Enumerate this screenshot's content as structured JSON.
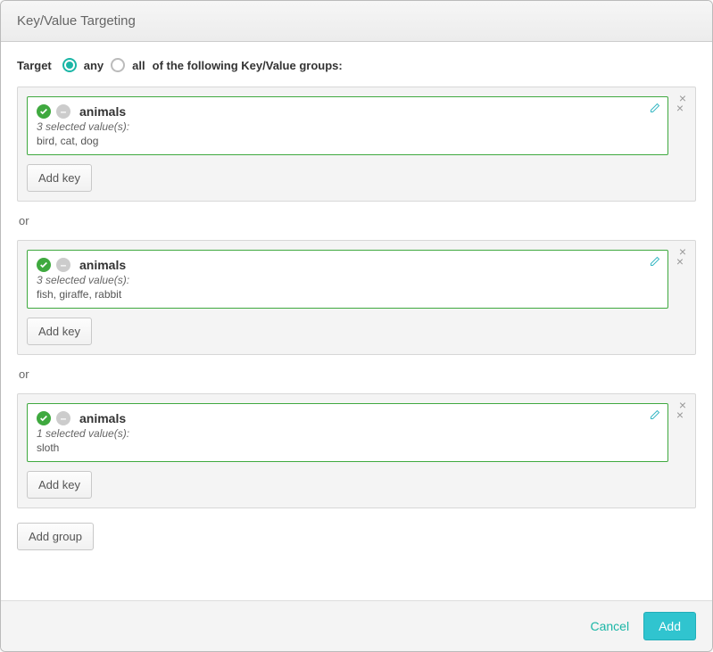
{
  "header": {
    "title": "Key/Value Targeting"
  },
  "target": {
    "label": "Target",
    "option_any": "any",
    "option_all": "all",
    "suffix": "of the following Key/Value groups:",
    "selected": "any"
  },
  "separator": "or",
  "groups": [
    {
      "keys": [
        {
          "name": "animals",
          "selected_label": "3 selected value(s):",
          "values": "bird, cat, dog"
        }
      ],
      "add_key_label": "Add key"
    },
    {
      "keys": [
        {
          "name": "animals",
          "selected_label": "3 selected value(s):",
          "values": "fish, giraffe, rabbit"
        }
      ],
      "add_key_label": "Add key"
    },
    {
      "keys": [
        {
          "name": "animals",
          "selected_label": "1 selected value(s):",
          "values": "sloth"
        }
      ],
      "add_key_label": "Add key"
    }
  ],
  "add_group_label": "Add group",
  "footer": {
    "cancel": "Cancel",
    "add": "Add"
  }
}
